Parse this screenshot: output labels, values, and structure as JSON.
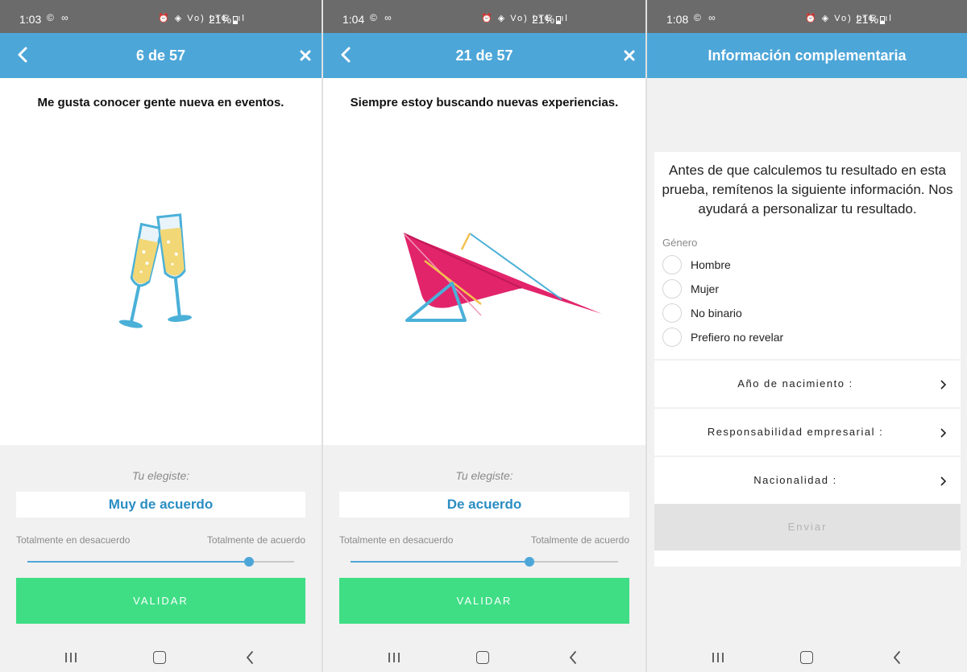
{
  "screens": [
    {
      "status": {
        "time": "1:03",
        "apps": "© ∞",
        "icons": "⏰ ◈ Vo) LTE .ıl",
        "battery": "21%"
      },
      "header": {
        "title": "6 de 57"
      },
      "question": "Me gusta conocer gente nueva en eventos.",
      "illustration": "champagne-glasses",
      "you_chose_label": "Tu elegiste:",
      "choice": "Muy de acuerdo",
      "scale_left": "Totalmente en desacuerdo",
      "scale_right": "Totalmente de acuerdo",
      "slider_level": 0.83,
      "validate_label": "VALIDAR"
    },
    {
      "status": {
        "time": "1:04",
        "apps": "© ∞",
        "icons": "⏰ ◈ Vo) LTE .ıl",
        "battery": "21%"
      },
      "header": {
        "title": "21 de 57"
      },
      "question": "Siempre estoy buscando nuevas experiencias.",
      "illustration": "hang-glider",
      "you_chose_label": "Tu elegiste:",
      "choice": "De acuerdo",
      "scale_left": "Totalmente en desacuerdo",
      "scale_right": "Totalmente de acuerdo",
      "slider_level": 0.67,
      "validate_label": "VALIDAR"
    },
    {
      "status": {
        "time": "1:08",
        "apps": "© ∞",
        "icons": "⏰ ◈ Vo) LTE .ıl",
        "battery": "21%"
      },
      "header": {
        "title": "Información complementaria"
      },
      "intro": "Antes de que calculemos tu resultado en esta prueba, remítenos la siguiente información. Nos ayudará a personalizar tu resultado.",
      "gender_label": "Género",
      "gender_options": [
        "Hombre",
        "Mujer",
        "No binario",
        "Prefiero no revelar"
      ],
      "pickers": [
        "Año de nacimiento :",
        "Responsabilidad empresarial :",
        "Nacionalidad :"
      ],
      "send_label": "Enviar"
    }
  ],
  "colors": {
    "status_bar": "#6b6b6b",
    "header": "#4da6d8",
    "choice_text": "#2a8dc3",
    "validate_button": "#3fde85",
    "send_button_disabled": "#e2e2e2"
  },
  "icons": [
    "chevron-left-icon",
    "close-icon",
    "recents-icon",
    "home-icon",
    "back-icon",
    "chevron-right-icon"
  ]
}
